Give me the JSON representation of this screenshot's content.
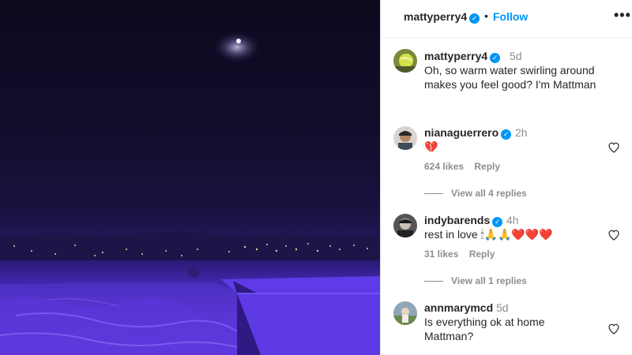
{
  "post": {
    "username": "mattyperry4",
    "dot": "•",
    "follow_label": "Follow",
    "more_label": "•••"
  },
  "caption": {
    "username": "mattyperry4",
    "time": "5d",
    "lines": [
      "Oh, so warm water swirling around",
      "makes you feel good? I'm Mattman"
    ]
  },
  "comments": [
    {
      "username": "nianaguerrero",
      "time": "2h",
      "text": "💔",
      "likes": "624 likes",
      "reply_label": "Reply",
      "view_replies": "View all 4 replies"
    },
    {
      "username": "indybarends",
      "time": "4h",
      "text": "rest in love 🕯🙏🙏❤️❤️❤️",
      "likes": "31 likes",
      "reply_label": "Reply",
      "view_replies": "View all 1 replies"
    },
    {
      "username": "annmarymcd",
      "time": "5d",
      "lines": [
        "Is everything ok at home",
        "Mattman?"
      ]
    }
  ],
  "colors": {
    "accent": "#0095f6",
    "text": "#262626",
    "muted": "#8e8e8e",
    "pool_purple": "#5a34d6"
  },
  "icons": [
    "verified-badge-icon",
    "more-options-icon",
    "heart-icon"
  ]
}
